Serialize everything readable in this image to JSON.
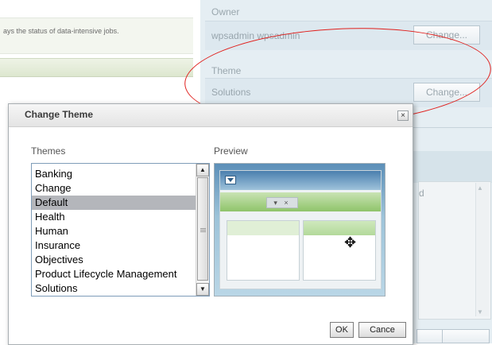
{
  "background": {
    "description_fragment": "ays the status of data-intensive jobs.",
    "owner": {
      "label": "Owner",
      "value": "wpsadmin wpsadmin",
      "change_label": "Change..."
    },
    "theme": {
      "label": "Theme",
      "value": "Solutions",
      "change_label": "Change..."
    },
    "textarea_fragment": "d"
  },
  "dialog": {
    "title": "Change Theme",
    "close_glyph": "×",
    "themes_label": "Themes",
    "preview_label": "Preview",
    "themes": [
      {
        "label": "Banking",
        "selected": false
      },
      {
        "label": "Change",
        "selected": false
      },
      {
        "label": "Default",
        "selected": true
      },
      {
        "label": "Health",
        "selected": false
      },
      {
        "label": "Human",
        "selected": false
      },
      {
        "label": "Insurance",
        "selected": false
      },
      {
        "label": "Objectives",
        "selected": false
      },
      {
        "label": "Product Lifecycle Management",
        "selected": false
      },
      {
        "label": "Solutions",
        "selected": false
      }
    ],
    "ok_label": "OK",
    "cancel_label": "Cance",
    "preview_controls": "▾ ×",
    "move_glyph": "✥"
  },
  "colors": {
    "annotation_ellipse": "#e0201d",
    "selected_row": "#b4b6bb"
  }
}
